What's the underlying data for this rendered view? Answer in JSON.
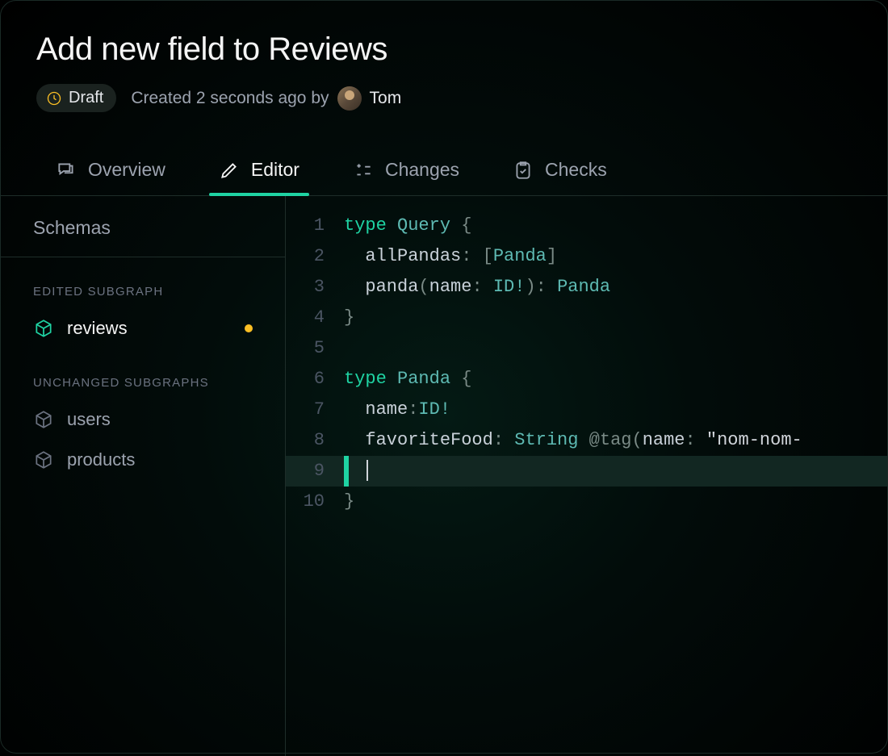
{
  "header": {
    "title": "Add new field to Reviews",
    "status": "Draft",
    "created_prefix": "Created 2 seconds ago by",
    "author": "Tom"
  },
  "tabs": [
    {
      "id": "overview",
      "label": "Overview",
      "active": false
    },
    {
      "id": "editor",
      "label": "Editor",
      "active": true
    },
    {
      "id": "changes",
      "label": "Changes",
      "active": false
    },
    {
      "id": "checks",
      "label": "Checks",
      "active": false
    }
  ],
  "sidebar": {
    "title": "Schemas",
    "sections": {
      "edited_label": "EDITED SUBGRAPH",
      "unchanged_label": "UNCHANGED SUBGRAPHS",
      "edited": [
        {
          "name": "reviews",
          "modified": true
        }
      ],
      "unchanged": [
        {
          "name": "users"
        },
        {
          "name": "products"
        }
      ]
    }
  },
  "editor": {
    "active_line": 9,
    "lines": [
      {
        "n": 1,
        "tokens": [
          [
            "kw",
            "type "
          ],
          [
            "type",
            "Query"
          ],
          [
            "punct",
            " {"
          ]
        ]
      },
      {
        "n": 2,
        "tokens": [
          [
            "ident",
            "  allPandas"
          ],
          [
            "punct",
            ": ["
          ],
          [
            "type",
            "Panda"
          ],
          [
            "punct",
            "]"
          ]
        ]
      },
      {
        "n": 3,
        "tokens": [
          [
            "ident",
            "  panda"
          ],
          [
            "punct",
            "("
          ],
          [
            "ident",
            "name"
          ],
          [
            "punct",
            ": "
          ],
          [
            "type",
            "ID!"
          ],
          [
            "punct",
            "): "
          ],
          [
            "type",
            "Panda"
          ]
        ]
      },
      {
        "n": 4,
        "tokens": [
          [
            "punct",
            "}"
          ]
        ]
      },
      {
        "n": 5,
        "tokens": []
      },
      {
        "n": 6,
        "tokens": [
          [
            "kw",
            "type "
          ],
          [
            "type",
            "Panda"
          ],
          [
            "punct",
            " {"
          ]
        ]
      },
      {
        "n": 7,
        "tokens": [
          [
            "ident",
            "  name"
          ],
          [
            "punct",
            ":"
          ],
          [
            "type",
            "ID!"
          ]
        ]
      },
      {
        "n": 8,
        "tokens": [
          [
            "ident",
            "  favoriteFood"
          ],
          [
            "punct",
            ": "
          ],
          [
            "type",
            "String"
          ],
          [
            "annot",
            " @tag"
          ],
          [
            "punct",
            "("
          ],
          [
            "ident",
            "name"
          ],
          [
            "punct",
            ": "
          ],
          [
            "str",
            "\"nom-nom-"
          ]
        ]
      },
      {
        "n": 9,
        "tokens": [
          [
            "ident",
            "  "
          ]
        ],
        "cursor": true
      },
      {
        "n": 10,
        "tokens": [
          [
            "punct",
            "}"
          ]
        ]
      }
    ]
  }
}
